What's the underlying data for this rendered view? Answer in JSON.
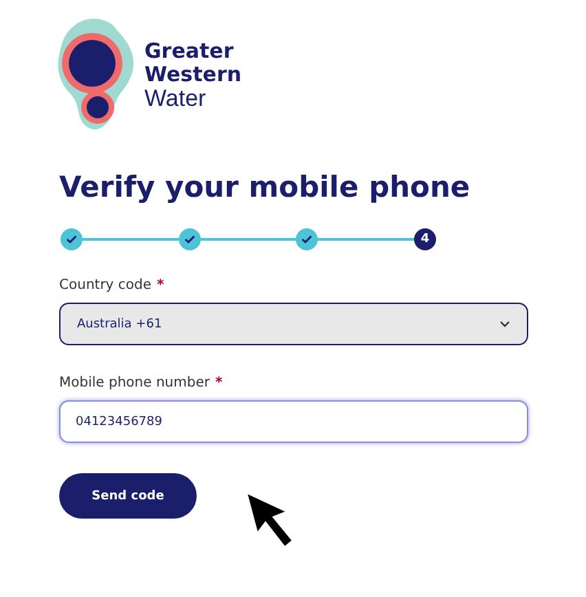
{
  "logo": {
    "lines": [
      "Greater",
      "Western",
      "Water"
    ]
  },
  "title": "Verify your mobile phone",
  "steps": [
    {
      "completed": true
    },
    {
      "completed": true
    },
    {
      "completed": true
    },
    {
      "completed": false,
      "label": "4"
    }
  ],
  "country": {
    "label": "Country code",
    "required_mark": "*",
    "value": "Australia +61"
  },
  "phone": {
    "label": "Mobile phone number",
    "required_mark": "*",
    "value": "04123456789",
    "focused": true
  },
  "button": "Send code"
}
